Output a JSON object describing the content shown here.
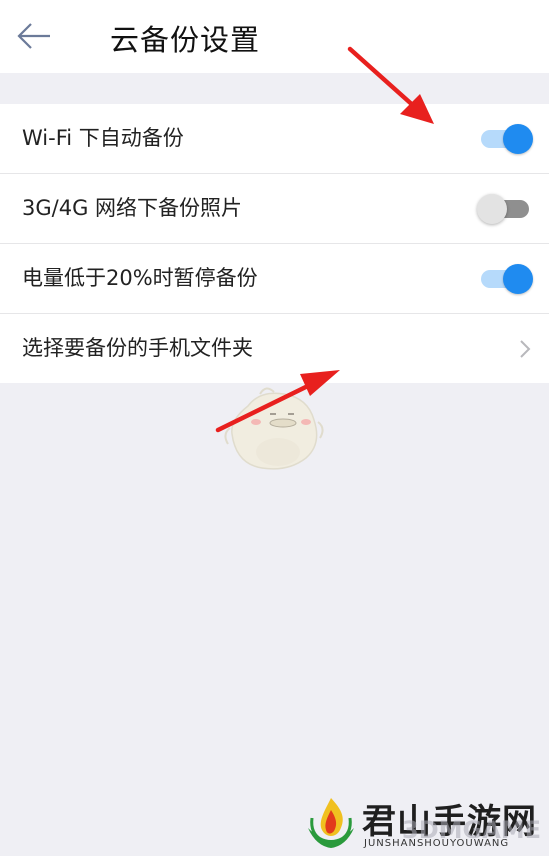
{
  "header": {
    "title": "云备份设置",
    "back_icon": "arrow-left-icon"
  },
  "settings": {
    "items": [
      {
        "label": "Wi-Fi 下自动备份",
        "control": "toggle",
        "enabled": true
      },
      {
        "label": "3G/4G 网络下备份照片",
        "control": "toggle",
        "enabled": false
      },
      {
        "label": "电量低于20%时暂停备份",
        "control": "toggle",
        "enabled": true
      },
      {
        "label": "选择要备份的手机文件夹",
        "control": "chevron-right-icon"
      }
    ]
  },
  "colors": {
    "toggle_on_thumb": "#1f8bf0",
    "toggle_on_track": "#b6dafb",
    "toggle_off_thumb": "#e3e3e3",
    "toggle_off_track": "#8f8f8f",
    "annotation_arrow": "#e8201e",
    "background": "#efeff4"
  },
  "watermark": {
    "title": "君山手游网",
    "subtitle": "JUNSHANSHOUYOUWANG",
    "overlay": "3DMGAME"
  }
}
